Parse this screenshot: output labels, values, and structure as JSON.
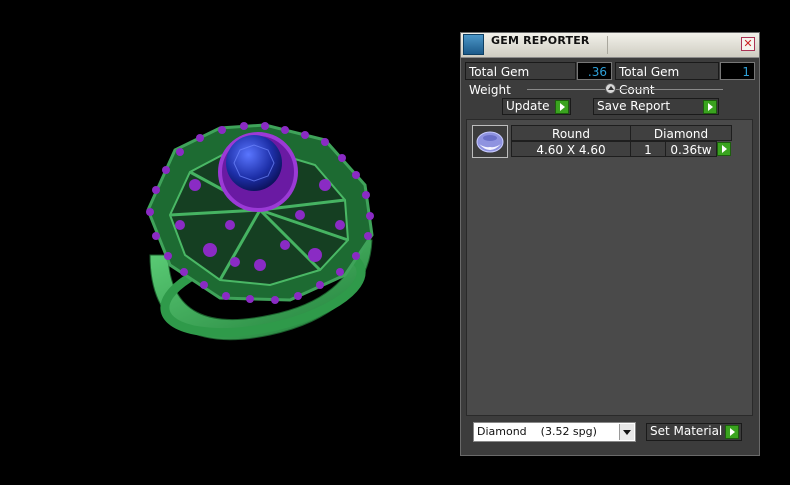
{
  "panel": {
    "title": "GEM REPORTER",
    "close_icon": "close-icon",
    "total_gem_weight_label": "Total Gem Weight",
    "total_gem_weight_value": ".36",
    "total_gem_count_label": "Total Gem Count",
    "total_gem_count_value": "1",
    "update_label": "Update",
    "save_report_label": "Save Report",
    "set_material_label": "Set Material",
    "material_selected": "Diamond    (3.52 spg)"
  },
  "gems": [
    {
      "shape": "Round",
      "material": "Diamond",
      "size": "4.60 X 4.60",
      "count": "1",
      "weight": "0.36tw"
    }
  ],
  "colors": {
    "metal": "#3fa35a",
    "accent_gems": "#8a2bc4",
    "center_stone": "#1d2fa8",
    "value_text": "#2ea0d8",
    "go_button": "#3aa31f"
  }
}
